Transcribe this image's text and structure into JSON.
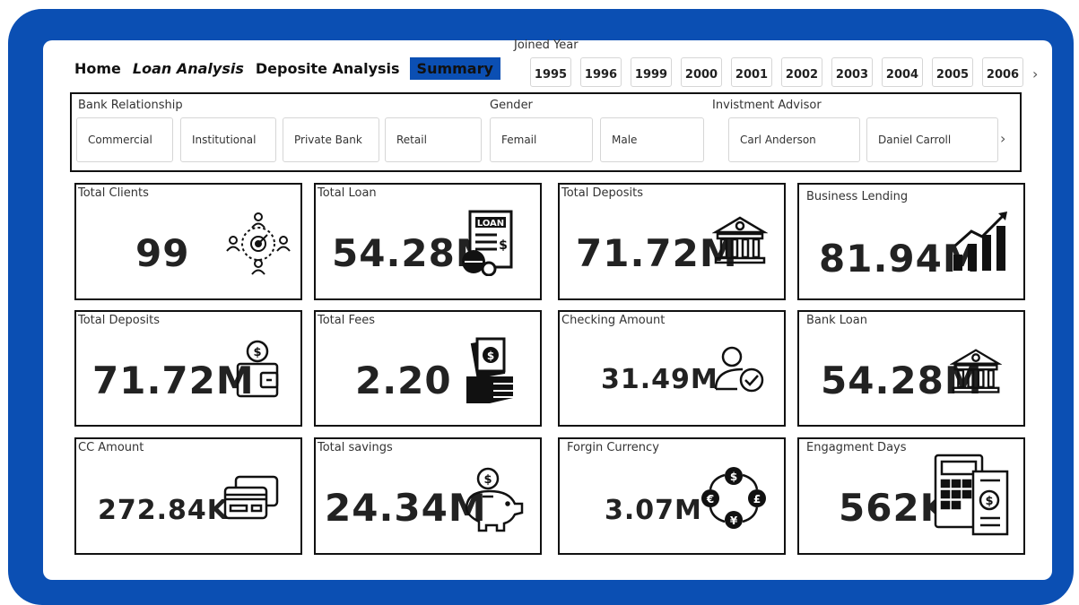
{
  "nav": {
    "home": "Home",
    "loan_analysis": "Loan Analysis",
    "deposite_analysis": "Deposite Analysis",
    "summary": "Summary"
  },
  "joined_year": {
    "label": "Joined Year",
    "years": [
      "1995",
      "1996",
      "1999",
      "2000",
      "2001",
      "2002",
      "2003",
      "2004",
      "2005",
      "2006"
    ]
  },
  "filters": {
    "bank_relationship": {
      "label": "Bank Relationship",
      "options": [
        "Commercial",
        "Institutional",
        "Private Bank",
        "Retail"
      ]
    },
    "gender": {
      "label": "Gender",
      "options": [
        "Femail",
        "Male"
      ]
    },
    "investment_advisor": {
      "label": "Invistment Advisor",
      "options": [
        "Carl Anderson",
        "Daniel Carroll"
      ]
    }
  },
  "cards": [
    {
      "title": "Total Clients",
      "value": "99",
      "icon": "target-people-icon"
    },
    {
      "title": "Total Loan",
      "value": "54.28M",
      "icon": "loan-document-icon"
    },
    {
      "title": "Total Deposits",
      "value": "71.72M",
      "icon": "bank-icon"
    },
    {
      "title": "Business Lending",
      "value": "81.94M",
      "icon": "growth-chart-icon"
    },
    {
      "title": "Total Deposits",
      "value": "71.72M",
      "icon": "wallet-coin-icon"
    },
    {
      "title": "Total Fees",
      "value": "2.20",
      "icon": "cash-hand-icon"
    },
    {
      "title": "Checking Amount",
      "value": "31.49M",
      "icon": "user-check-icon"
    },
    {
      "title": "Bank Loan",
      "value": "54.28M",
      "icon": "bank-icon"
    },
    {
      "title": "CC Amount",
      "value": "272.84K",
      "icon": "credit-cards-icon"
    },
    {
      "title": "Total savings",
      "value": "24.34M",
      "icon": "piggy-bank-icon"
    },
    {
      "title": "Forgin Currency",
      "value": "3.07M",
      "icon": "currency-exchange-icon"
    },
    {
      "title": "Engagment Days",
      "value": "562K",
      "icon": "calculator-invoice-icon"
    }
  ],
  "colors": {
    "frame": "#0b4fb3",
    "active_tab": "#0b4fb3",
    "card_border": "#111111"
  }
}
